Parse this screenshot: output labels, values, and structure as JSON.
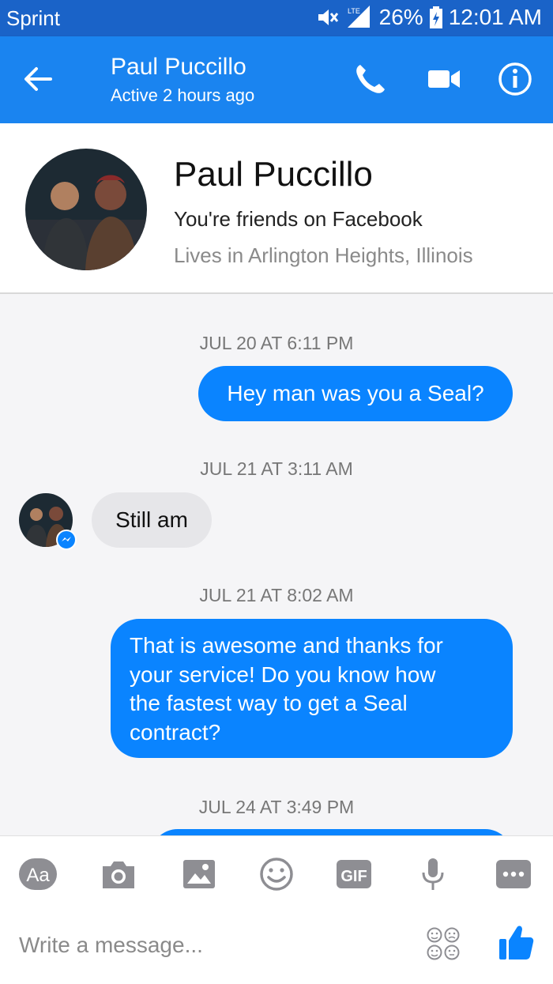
{
  "status_bar": {
    "carrier": "Sprint",
    "network": "LTE",
    "battery": "26%",
    "time": "12:01 AM"
  },
  "header": {
    "title": "Paul Puccillo",
    "subtitle": "Active 2 hours ago",
    "icons": [
      "back-arrow-icon",
      "phone-icon",
      "video-camera-icon",
      "info-icon"
    ]
  },
  "profile": {
    "name": "Paul Puccillo",
    "line1": "You're friends on Facebook",
    "line2": "Lives in Arlington Heights, Illinois"
  },
  "messages": [
    {
      "timestamp": "JUL 20 AT 6:11 PM",
      "direction": "out",
      "text": "Hey man was you a Seal?"
    },
    {
      "timestamp": "JUL 21 AT 3:11 AM",
      "direction": "in",
      "text": "Still am"
    },
    {
      "timestamp": "JUL 21 AT 8:02 AM",
      "direction": "out",
      "lines": [
        "That is awesome and thanks for",
        "your service! Do you know how",
        "the fastest way to get a Seal",
        "contract?"
      ]
    },
    {
      "timestamp": "JUL 24 AT 3:49 PM",
      "direction": "out",
      "text": ""
    }
  ],
  "composer": {
    "placeholder": "Write a message...",
    "toolbar": {
      "text_label": "Aa",
      "gif_label": "GIF"
    },
    "icons": [
      "text-format-icon",
      "camera-icon",
      "image-icon",
      "emoji-icon",
      "gif-icon",
      "microphone-icon",
      "more-icon",
      "stickers-icon",
      "thumbs-up-icon"
    ]
  },
  "colors": {
    "status_bar": "#1a63c8",
    "app_bar": "#1a84f0",
    "outgoing_bubble": "#0a84ff",
    "incoming_bubble": "#e6e6e9"
  }
}
